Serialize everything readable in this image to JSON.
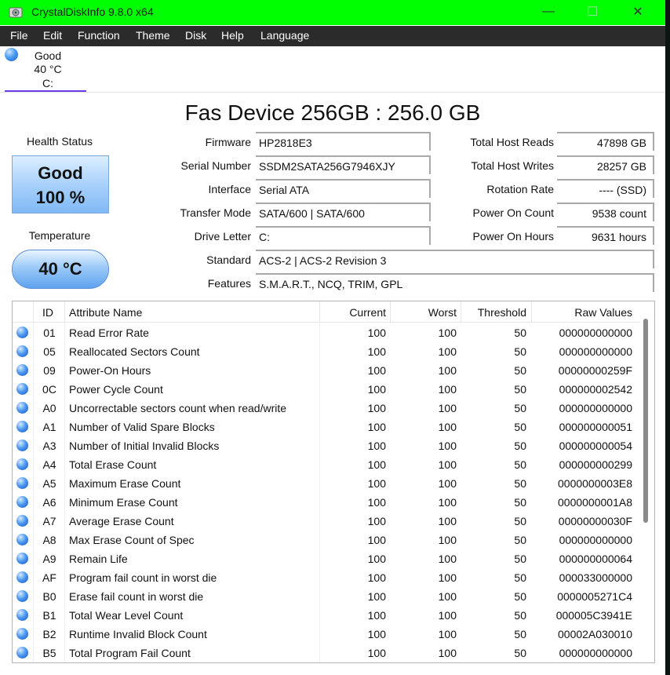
{
  "window": {
    "title": "CrystalDiskInfo 9.8.0 x64",
    "titlebar_color": "#00ff00",
    "controls": {
      "minimize": "—",
      "maximize": "☐",
      "close": "✕"
    }
  },
  "menu": [
    "File",
    "Edit",
    "Function",
    "Theme",
    "Disk",
    "Help",
    "Language"
  ],
  "disk_tab": {
    "status": "Good",
    "temp": "40 °C",
    "letter": "C:"
  },
  "drive": {
    "title": "Fas Device 256GB : 256.0 GB",
    "health_label": "Health Status",
    "health_status": "Good",
    "health_percent": "100 %",
    "temp_label": "Temperature",
    "temp_value": "40 °C",
    "firmware_label": "Firmware",
    "firmware": "HP2818E3",
    "serial_label": "Serial Number",
    "serial": "SSDM2SATA256G7946XJY",
    "interface_label": "Interface",
    "interface": "Serial ATA",
    "transfer_label": "Transfer Mode",
    "transfer": "SATA/600 | SATA/600",
    "letter_label": "Drive Letter",
    "letter": "C:",
    "standard_label": "Standard",
    "standard": "ACS-2 | ACS-2 Revision 3",
    "features_label": "Features",
    "features": "S.M.A.R.T., NCQ, TRIM, GPL",
    "reads_label": "Total Host Reads",
    "reads": "47898 GB",
    "writes_label": "Total Host Writes",
    "writes": "28257 GB",
    "rotation_label": "Rotation Rate",
    "rotation": "---- (SSD)",
    "poweron_count_label": "Power On Count",
    "poweron_count": "9538 count",
    "poweron_hours_label": "Power On Hours",
    "poweron_hours": "9631 hours"
  },
  "smart": {
    "headers": {
      "id": "ID",
      "name": "Attribute Name",
      "current": "Current",
      "worst": "Worst",
      "threshold": "Threshold",
      "raw": "Raw Values"
    },
    "rows": [
      {
        "id": "01",
        "name": "Read Error Rate",
        "current": "100",
        "worst": "100",
        "threshold": "50",
        "raw": "000000000000"
      },
      {
        "id": "05",
        "name": "Reallocated Sectors Count",
        "current": "100",
        "worst": "100",
        "threshold": "50",
        "raw": "000000000000"
      },
      {
        "id": "09",
        "name": "Power-On Hours",
        "current": "100",
        "worst": "100",
        "threshold": "50",
        "raw": "00000000259F"
      },
      {
        "id": "0C",
        "name": "Power Cycle Count",
        "current": "100",
        "worst": "100",
        "threshold": "50",
        "raw": "000000002542"
      },
      {
        "id": "A0",
        "name": "Uncorrectable sectors count when read/write",
        "current": "100",
        "worst": "100",
        "threshold": "50",
        "raw": "000000000000"
      },
      {
        "id": "A1",
        "name": "Number of Valid Spare Blocks",
        "current": "100",
        "worst": "100",
        "threshold": "50",
        "raw": "000000000051"
      },
      {
        "id": "A3",
        "name": "Number of Initial Invalid Blocks",
        "current": "100",
        "worst": "100",
        "threshold": "50",
        "raw": "000000000054"
      },
      {
        "id": "A4",
        "name": "Total Erase Count",
        "current": "100",
        "worst": "100",
        "threshold": "50",
        "raw": "000000000299"
      },
      {
        "id": "A5",
        "name": "Maximum Erase Count",
        "current": "100",
        "worst": "100",
        "threshold": "50",
        "raw": "0000000003E8"
      },
      {
        "id": "A6",
        "name": "Minimum Erase Count",
        "current": "100",
        "worst": "100",
        "threshold": "50",
        "raw": "0000000001A8"
      },
      {
        "id": "A7",
        "name": "Average Erase Count",
        "current": "100",
        "worst": "100",
        "threshold": "50",
        "raw": "00000000030F"
      },
      {
        "id": "A8",
        "name": "Max Erase Count of Spec",
        "current": "100",
        "worst": "100",
        "threshold": "50",
        "raw": "000000000000"
      },
      {
        "id": "A9",
        "name": "Remain Life",
        "current": "100",
        "worst": "100",
        "threshold": "50",
        "raw": "000000000064"
      },
      {
        "id": "AF",
        "name": "Program fail count in worst die",
        "current": "100",
        "worst": "100",
        "threshold": "50",
        "raw": "000033000000"
      },
      {
        "id": "B0",
        "name": "Erase fail count in worst die",
        "current": "100",
        "worst": "100",
        "threshold": "50",
        "raw": "0000005271C4"
      },
      {
        "id": "B1",
        "name": "Total Wear Level Count",
        "current": "100",
        "worst": "100",
        "threshold": "50",
        "raw": "000005C3941E"
      },
      {
        "id": "B2",
        "name": "Runtime Invalid Block Count",
        "current": "100",
        "worst": "100",
        "threshold": "50",
        "raw": "00002A030010"
      },
      {
        "id": "B5",
        "name": "Total Program Fail Count",
        "current": "100",
        "worst": "100",
        "threshold": "50",
        "raw": "000000000000"
      }
    ]
  }
}
